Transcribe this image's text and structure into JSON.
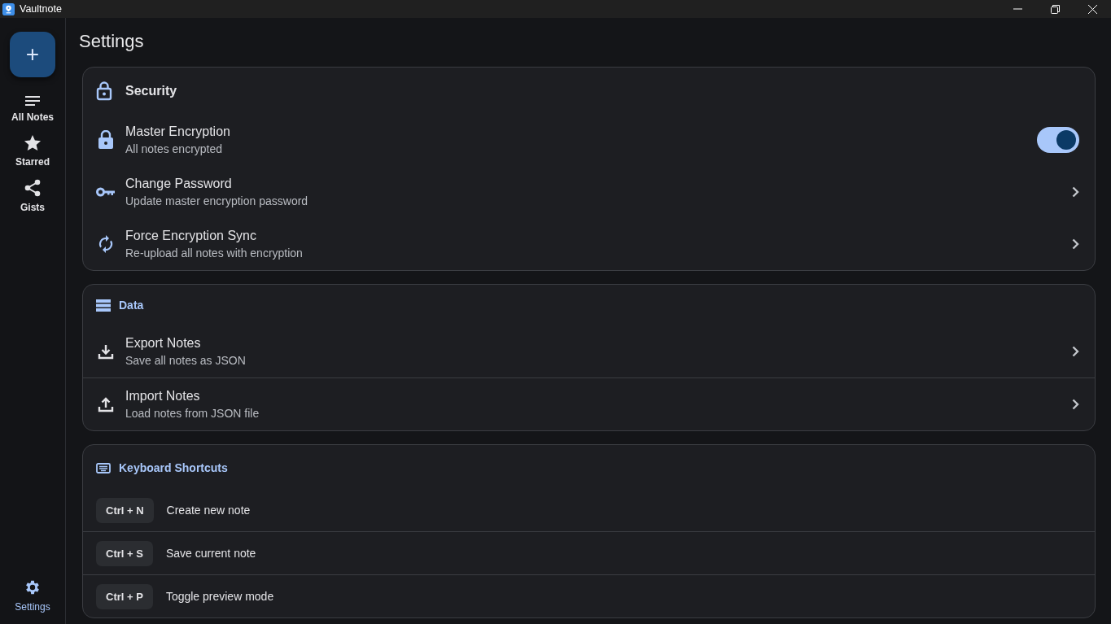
{
  "window": {
    "title": "Vaultnote"
  },
  "sidebar": {
    "new_button": "+",
    "items": [
      {
        "label": "All Notes",
        "selected": false
      },
      {
        "label": "Starred",
        "selected": false
      },
      {
        "label": "Gists",
        "selected": false
      }
    ],
    "footer_item": {
      "label": "Settings",
      "selected": true
    }
  },
  "page_title": "Settings",
  "sections": [
    {
      "title": "Security",
      "rows": [
        {
          "kind": "toggle",
          "title": "Master Encryption",
          "subtitle": "All notes encrypted",
          "on": true
        },
        {
          "kind": "link",
          "title": "Change Password",
          "subtitle": "Update master encryption password"
        },
        {
          "kind": "link",
          "title": "Force Encryption Sync",
          "subtitle": "Re-upload all notes with encryption"
        }
      ]
    },
    {
      "title": "Data",
      "rows": [
        {
          "kind": "link",
          "title": "Export Notes",
          "subtitle": "Save all notes as JSON"
        },
        {
          "kind": "link",
          "title": "Import Notes",
          "subtitle": "Load notes from JSON file"
        }
      ]
    }
  ],
  "shortcuts": {
    "title": "Keyboard Shortcuts",
    "items": [
      {
        "keys": "Ctrl + N",
        "action": "Create new note"
      },
      {
        "keys": "Ctrl + S",
        "action": "Save current note"
      },
      {
        "keys": "Ctrl + P",
        "action": "Toggle preview mode"
      }
    ]
  }
}
